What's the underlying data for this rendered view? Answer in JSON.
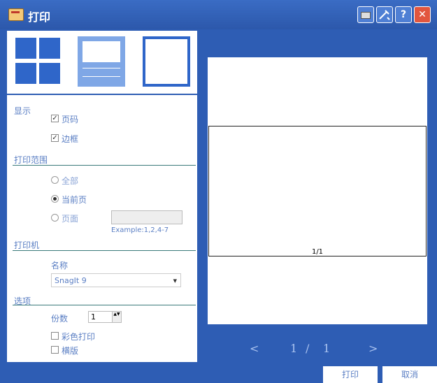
{
  "window": {
    "title": "打印"
  },
  "display": {
    "section_label": "显示",
    "page_number_label": "页码",
    "border_label": "边框",
    "page_number_checked": true,
    "border_checked": true
  },
  "print_range": {
    "section_label": "打印范围",
    "all_label": "全部",
    "current_label": "当前页",
    "pages_label": "页面",
    "pages_value": "",
    "example": "Example:1,2,4-7",
    "selected": "current"
  },
  "printer": {
    "section_label": "打印机",
    "name_label": "名称",
    "name_value": "SnagIt 9"
  },
  "options": {
    "section_label": "选项",
    "copies_label": "份数",
    "copies_value": "1",
    "color_label": "彩色打印",
    "landscape_label": "横版",
    "color_checked": false,
    "landscape_checked": false
  },
  "preview": {
    "page_label": "1/1",
    "prev": "<",
    "current": "1",
    "separator": "/",
    "total": "1",
    "next": ">"
  },
  "buttons": {
    "print": "打印",
    "cancel": "取消"
  },
  "check_mark": "✓",
  "spin_arrows": "▲▼",
  "select_arrow": "▼",
  "help_mark": "?",
  "close_mark": "✕"
}
